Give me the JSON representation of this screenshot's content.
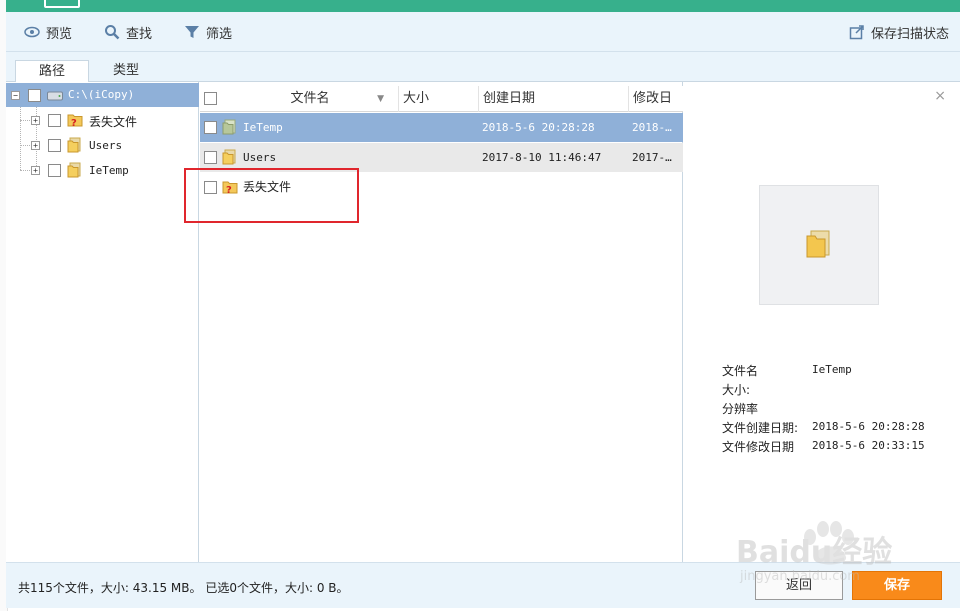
{
  "toolbar": {
    "preview_label": "预览",
    "search_label": "查找",
    "filter_label": "筛选",
    "save_scan_label": "保存扫描状态"
  },
  "tabs": [
    {
      "label": "路径",
      "active": true
    },
    {
      "label": "类型",
      "active": false
    }
  ],
  "tree": {
    "root": {
      "label": "C:\\(iCopy)",
      "icon": "drive-icon"
    },
    "children": [
      {
        "label": "丢失文件",
        "icon": "lost-folder-icon"
      },
      {
        "label": "Users",
        "icon": "folder-icon"
      },
      {
        "label": "IeTemp",
        "icon": "folder-icon"
      }
    ]
  },
  "file_list": {
    "columns": [
      "文件名",
      "大小",
      "创建日期",
      "修改日期"
    ],
    "rows": [
      {
        "name": "IeTemp",
        "size": "",
        "created": "2018-5-6 20:28:28",
        "modified": "2018-…",
        "icon": "folder-icon",
        "selected": true
      },
      {
        "name": "Users",
        "size": "",
        "created": "2017-8-10 11:46:47",
        "modified": "2017-…",
        "icon": "folder-icon",
        "selected": false
      },
      {
        "name": "丢失文件",
        "size": "",
        "created": "",
        "modified": "",
        "icon": "lost-folder-icon",
        "selected": false
      }
    ]
  },
  "preview": {
    "close": "×",
    "info": [
      {
        "key": "文件名",
        "value": "IeTemp"
      },
      {
        "key": "大小:",
        "value": ""
      },
      {
        "key": "分辨率",
        "value": ""
      },
      {
        "key": "文件创建日期:",
        "value": "2018-5-6 20:28:28"
      },
      {
        "key": "文件修改日期",
        "value": "2018-5-6 20:33:15"
      }
    ]
  },
  "status": {
    "summary": "共115个文件，大小: 43.15 MB。 已选0个文件，大小: 0 B。",
    "back_label": "返回",
    "save_label": "保存"
  },
  "watermark": {
    "text": "Baidu经验",
    "sub": "jingyan.baidu.com"
  },
  "colors": {
    "titlebar": "#37b08c",
    "toolbar_bg": "#eaf4fb",
    "selection": "#8fb0d8",
    "highlight": "#e0262d",
    "save_button": "#f98a1a"
  }
}
